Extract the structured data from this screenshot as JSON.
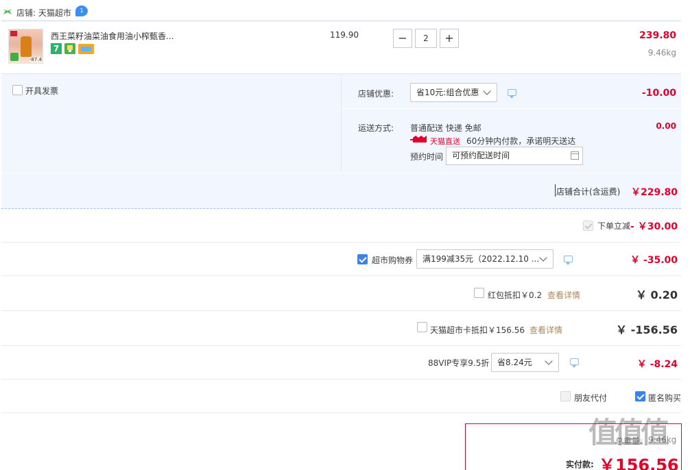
{
  "shop": {
    "label": "店铺: 天猫超市",
    "badge": "1"
  },
  "product": {
    "title": "西王菜籽油菜油食用油小榨甄香...",
    "thumb_tag": "-87.4",
    "unit_price": "119.90",
    "quantity": "2",
    "minus": "−",
    "plus": "+",
    "total": "239.80",
    "weight": "9.46kg",
    "badge_seven": "7"
  },
  "order_opts": {
    "invoice_label": "开具发票",
    "shop_discount_label": "店铺优惠:",
    "shop_discount_value": "省10元:组合优惠",
    "shop_discount_amount": "-10.00",
    "delivery_label": "运送方式:",
    "delivery_value": "普通配送 快递 免邮",
    "delivery_amount": "0.00",
    "tmall_direct": "天猫直送",
    "direct_note": "60分钟内付款，承诺明天送达",
    "reserve_label": "预约时间",
    "reserve_placeholder": "可预约配送时间",
    "shop_total_label": "店铺合计(含运费)",
    "shop_total_value": "￥229.80"
  },
  "discounts": {
    "instant_label": "下单立减",
    "instant_value": "- ￥30.00",
    "coupon_label": "超市购物券",
    "coupon_value": "满199减35元（2022.12.10 ...",
    "coupon_amount": "￥ -35.00",
    "redpacket_label": "红包抵扣￥0.2",
    "redpacket_link": "查看详情",
    "redpacket_amount": "￥ 0.20",
    "card_label": "天猫超市卡抵扣￥156.56",
    "card_link": "查看详情",
    "card_amount": "￥ -156.56",
    "vip_label": "88VIP专享9.5折",
    "vip_value": "省8.24元",
    "vip_amount": "￥ -8.24",
    "friend_pay": "朋友代付",
    "anonymous": "匿名购买"
  },
  "summary": {
    "weight_label": "总重量:",
    "weight_value": "9.46kg",
    "pay_label": "实付款:",
    "pay_value": "￥156.56"
  },
  "watermark": "值值值",
  "colors": {
    "accent_red": "#e4002b",
    "blue": "#3a84e6",
    "panel_bg": "#f2f7ff"
  }
}
